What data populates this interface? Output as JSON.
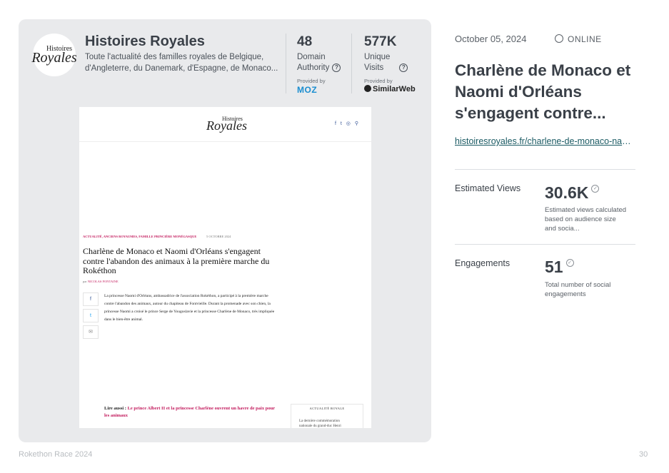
{
  "publication": {
    "logo_line1": "Histoires",
    "logo_line2": "Royales",
    "name": "Histoires Royales",
    "description": "Toute l'actualité des familles royales de Belgique, d'Angleterre, du Danemark, d'Espagne, de Monaco..."
  },
  "metrics": {
    "domain_authority": {
      "value": "48",
      "label_line1": "Domain",
      "label_line2": "Authority",
      "provided_by": "Provided by",
      "provider": "MOZ"
    },
    "unique_visits": {
      "value": "577K",
      "label_line1": "Unique",
      "label_line2": "Visits",
      "provided_by": "Provided by",
      "provider": "SimilarWeb"
    }
  },
  "screenshot": {
    "logo_small": "Histoires",
    "logo_big": "Royales",
    "header_icons": "f t ◎ ⚲",
    "categories": "ACTUALITÉ, ANCIENS ROYAUMES, FAMILLE PRINCIÈRE MONÉGASQUE",
    "date": "5 OCTOBRE 2024",
    "title": "Charlène de Monaco et Naomi d'Orléans s'engagent contre l'abandon des animaux à la première marche du Rokéthon",
    "author_prefix": "par",
    "author": "NICOLAS FONTAINE",
    "share_icons": [
      "f",
      "t",
      "✉"
    ],
    "body": "La princesse Naomi d'Orléans, ambassadrice de l'association Rokéthon, a participé à la première marche contre l'abandon des animaux, autour du chapiteau de Fontvieille. Durant la promenade avec son chien, la princesse Naomi a croisé le prince Serge de Yougoslavie et la princesse Charlène de Monaco, très impliquée dans le bien-être animal.",
    "lire_prefix": "Lire aussi :",
    "lire_link": "Le prince Albert II et la princesse Charlène ouvrent un havre de paix pour les animaux",
    "sidebar_title": "ACTUALITÉ ROYALE",
    "sidebar_text": "La dernière commémoration nationale du grand-duc Henri de"
  },
  "article": {
    "date": "October 05, 2024",
    "status": "ONLINE",
    "title": "Charlène de Monaco et Naomi d'Orléans s'engagent contre...",
    "url": "histoiresroyales.fr/charlene-de-monaco-naomi-dorleans"
  },
  "stats": {
    "views_label": "Estimated Views",
    "views_value": "30.6K",
    "views_desc": "Estimated views calculated based on audience size and socia...",
    "engagements_label": "Engagements",
    "engagements_value": "51",
    "engagements_desc": "Total number of social engagements"
  },
  "footer": {
    "left": "Rokethon Race 2024",
    "page": "30"
  },
  "colors": {
    "card_bg": "#e9eaec",
    "text_dark": "#3a4048",
    "link": "#1a5a63",
    "accent_pink": "#c2185b",
    "moz_blue": "#1b8ed0"
  }
}
